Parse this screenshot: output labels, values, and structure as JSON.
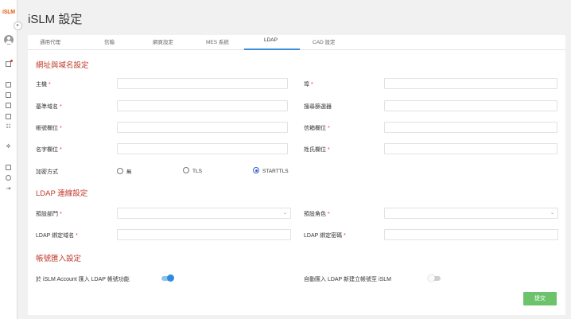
{
  "app": {
    "logo_text": "iSLM",
    "page_title": "iSLM 設定"
  },
  "rail": {
    "collapse_glyph": "▸",
    "icons": [
      "avatar-icon",
      "external-link-icon",
      "inbox-icon",
      "folder-icon",
      "list-icon",
      "document-icon",
      "people-icon",
      "gear-icon",
      "table-icon",
      "help-icon",
      "logout-icon"
    ]
  },
  "tabs": [
    {
      "label": "通用代理"
    },
    {
      "label": "信箱"
    },
    {
      "label": "網頁設定"
    },
    {
      "label": "MES 系統"
    },
    {
      "label": "LDAP"
    },
    {
      "label": "CAD 設定"
    }
  ],
  "active_tab": "LDAP",
  "sections": {
    "address": "網址與域名設定",
    "connection": "LDAP 連線設定",
    "import": "帳號匯入設定"
  },
  "fields": {
    "host": "主機",
    "port": "埠",
    "base_dn": "基準域名",
    "search_filter": "搜尋篩選器",
    "account_field": "帳號欄位",
    "email_field": "信箱欄位",
    "name_field": "名字欄位",
    "surname_field": "姓氏欄位",
    "encryption": "加密方式",
    "default_dept": "預設部門",
    "default_role": "預設角色",
    "bind_dn": "LDAP 綁定域名",
    "bind_password": "LDAP 綁定密碼"
  },
  "required_mark": "*",
  "encryption_options": [
    {
      "label": "無",
      "selected": false
    },
    {
      "label": "TLS",
      "selected": false
    },
    {
      "label": "STARTTLS",
      "selected": true
    }
  ],
  "toggles": {
    "import_ldap_label": "於 iSLM Account 匯入 LDAP 帳號功能",
    "import_ldap_on": true,
    "auto_import_label": "自動匯入 LDAP 新建立帳號至 iSLM",
    "auto_import_on": false
  },
  "submit_label": "提交",
  "colors": {
    "accent": "#3a8ed8",
    "section_title": "#c0392b",
    "required": "#e53935",
    "submit": "#6cc36c",
    "logo": "#e8590c"
  }
}
